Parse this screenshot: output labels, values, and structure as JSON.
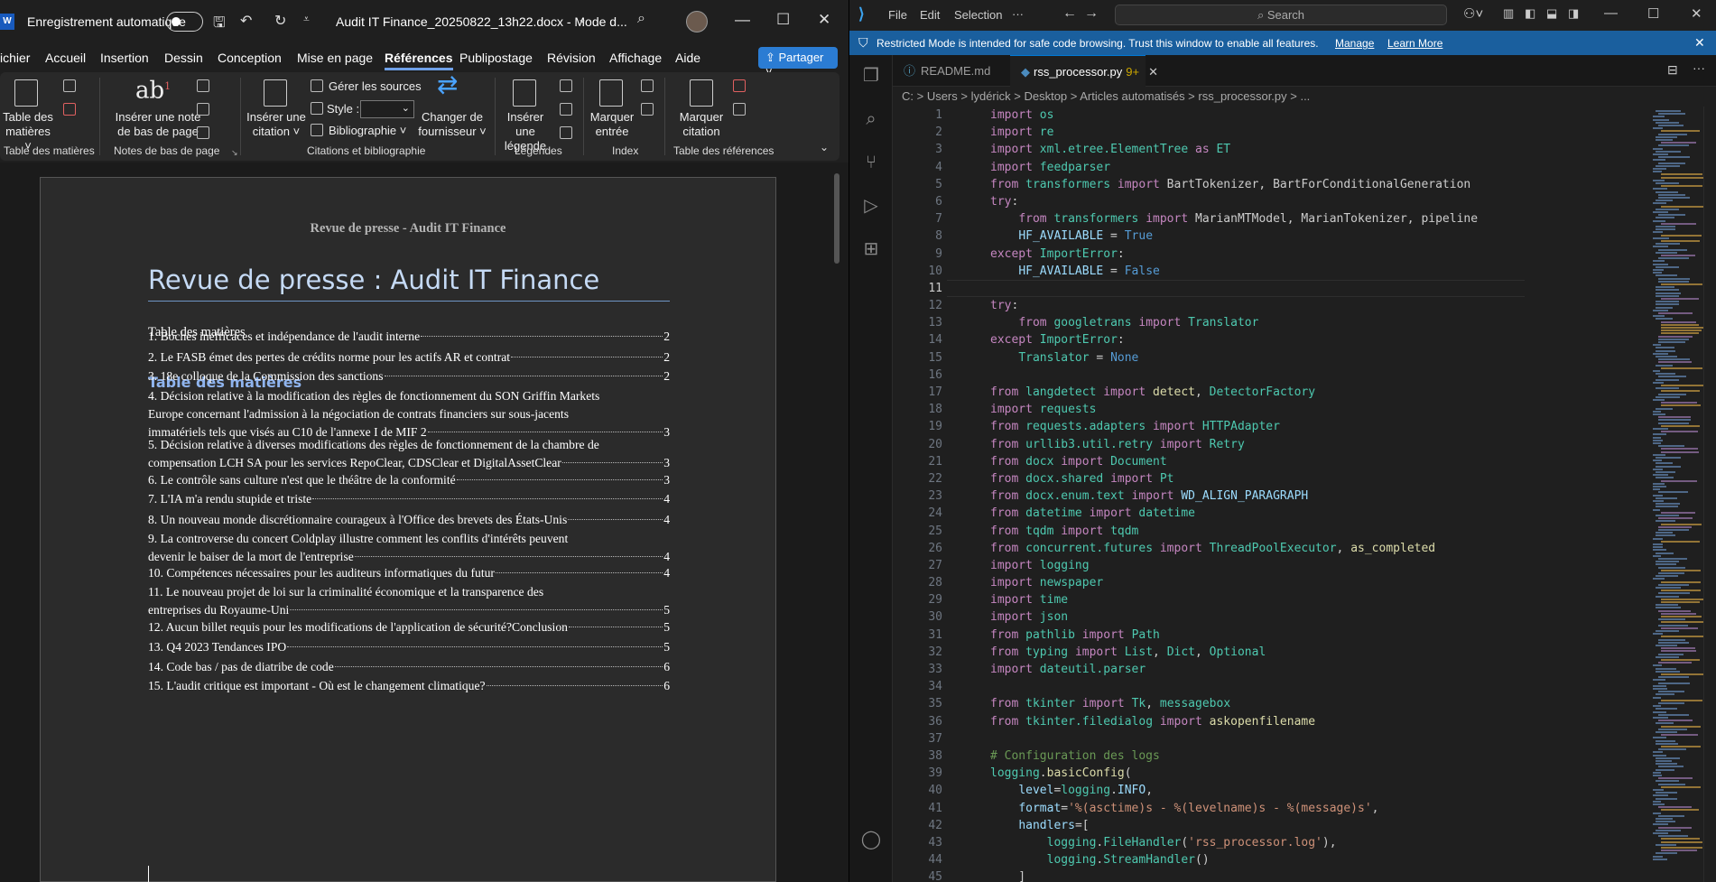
{
  "word": {
    "logo": "W",
    "autosave": "Enregistrement automatique",
    "doc_title": "Audit IT Finance_20250822_13h22.docx  -  Mode d...",
    "menu": [
      "ichier",
      "Accueil",
      "Insertion",
      "Dessin",
      "Conception",
      "Mise en page",
      "Références",
      "Publipostage",
      "Révision",
      "Affichage",
      "Aide"
    ],
    "share": "Partager",
    "ribbon": {
      "toc_btn": [
        "Table des",
        "matières ˅"
      ],
      "insert_note": [
        "Insérer une note",
        "de bas de page"
      ],
      "insert_citation": [
        "Insérer une",
        "citation ˅"
      ],
      "manage_sources": "Gérer les sources",
      "style": "Style :",
      "bibliography": "Bibliographie ˅",
      "change_provider": [
        "Changer de",
        "fournisseur ˅"
      ],
      "insert_caption": [
        "Insérer une",
        "légende"
      ],
      "mark_entry": [
        "Marquer",
        "entrée"
      ],
      "mark_citation": [
        "Marquer",
        "citation"
      ],
      "groups": [
        "Table des matières",
        "Notes de bas de page",
        "Citations et bibliographie",
        "Légendes",
        "Index",
        "Table des références"
      ]
    },
    "page": {
      "header": "Revue de presse - Audit IT Finance",
      "title": "Revue de presse : Audit IT Finance",
      "toc_label": "Table des matières",
      "toc_heading": "Table des matières",
      "entries": [
        {
          "lines": [
            "1. Boches inefficaces et indépendance de l'audit interne"
          ],
          "page": "2"
        },
        {
          "lines": [
            "2. Le FASB émet des pertes de crédits norme pour les actifs AR et contrat"
          ],
          "page": "2"
        },
        {
          "lines": [
            "3. 18e colloque de la Commission des sanctions"
          ],
          "page": "2"
        },
        {
          "lines": [
            "4. Décision relative à la modification des règles de fonctionnement du SON Griffin Markets",
            "Europe concernant l'admission à la négociation de contrats financiers sur sous-jacents",
            "immatériels tels que visés au C10 de l'annexe I de MIF 2"
          ],
          "page": "3"
        },
        {
          "lines": [
            "5. Décision relative à diverses modifications des règles de fonctionnement de la chambre de",
            "compensation LCH SA pour les services RepoClear, CDSClear et DigitalAssetClear"
          ],
          "page": "3"
        },
        {
          "lines": [
            "6. Le contrôle sans culture n'est que le théâtre de la conformité"
          ],
          "page": "3"
        },
        {
          "lines": [
            "7. L'IA m'a rendu stupide et triste"
          ],
          "page": "4"
        },
        {
          "lines": [
            "8. Un nouveau monde discrétionnaire courageux à l'Office des brevets des États-Unis"
          ],
          "page": "4"
        },
        {
          "lines": [
            "9. La controverse du concert Coldplay illustre comment les conflits d'intérêts peuvent",
            "devenir le baiser de la mort de l'entreprise"
          ],
          "page": "4"
        },
        {
          "lines": [
            "10. Compétences nécessaires pour les auditeurs informatiques du futur"
          ],
          "page": "4"
        },
        {
          "lines": [
            "11. Le nouveau projet de loi sur la criminalité économique et la transparence des",
            "entreprises du Royaume-Uni"
          ],
          "page": "5"
        },
        {
          "lines": [
            "12. Aucun billet requis pour les modifications de l'application de sécurité?Conclusion"
          ],
          "page": "5"
        },
        {
          "lines": [
            "13. Q4 2023 Tendances IPO"
          ],
          "page": "5"
        },
        {
          "lines": [
            "14. Code bas / pas de diatribe de code"
          ],
          "page": "6"
        },
        {
          "lines": [
            "15. L'audit critique est important - Où est le changement climatique?"
          ],
          "page": "6"
        }
      ]
    }
  },
  "vscode": {
    "menu": [
      "File",
      "Edit",
      "Selection",
      "···"
    ],
    "search": "Search",
    "banner": {
      "text": "Restricted Mode is intended for safe code browsing. Trust this window to enable all features.",
      "manage": "Manage",
      "learn": "Learn More"
    },
    "tabs": [
      {
        "label": "README.md"
      },
      {
        "label": "rss_processor.py",
        "mod": "9+"
      }
    ],
    "breadcrumb": "C: > Users > lydérick > Desktop > Articles automatisés > rss_processor.py > ...",
    "current_line": 11,
    "colors": {
      "kw": "#c586c0",
      "mod": "#4ec9b0",
      "fn": "#dcdcaa",
      "str": "#ce9178",
      "var": "#9cdcfe",
      "const": "#569cd6",
      "cmt": "#6a9955",
      "plain": "#cccccc"
    },
    "lines": [
      [
        [
          "kw",
          "import"
        ],
        [
          "plain",
          " "
        ],
        [
          "mod",
          "os"
        ]
      ],
      [
        [
          "kw",
          "import"
        ],
        [
          "plain",
          " "
        ],
        [
          "mod",
          "re"
        ]
      ],
      [
        [
          "kw",
          "import"
        ],
        [
          "plain",
          " "
        ],
        [
          "mod",
          "xml.etree.ElementTree"
        ],
        [
          "plain",
          " "
        ],
        [
          "kw",
          "as"
        ],
        [
          "plain",
          " "
        ],
        [
          "mod",
          "ET"
        ]
      ],
      [
        [
          "kw",
          "import"
        ],
        [
          "plain",
          " "
        ],
        [
          "mod",
          "feedparser"
        ]
      ],
      [
        [
          "kw",
          "from"
        ],
        [
          "plain",
          " "
        ],
        [
          "mod",
          "transformers"
        ],
        [
          "plain",
          " "
        ],
        [
          "kw",
          "import"
        ],
        [
          "plain",
          " BartTokenizer, BartForConditionalGeneration"
        ]
      ],
      [
        [
          "kw",
          "try"
        ],
        [
          "plain",
          ":"
        ]
      ],
      [
        [
          "plain",
          "    "
        ],
        [
          "kw",
          "from"
        ],
        [
          "plain",
          " "
        ],
        [
          "mod",
          "transformers"
        ],
        [
          "plain",
          " "
        ],
        [
          "kw",
          "import"
        ],
        [
          "plain",
          " MarianMTModel, MarianTokenizer, pipeline"
        ]
      ],
      [
        [
          "plain",
          "    "
        ],
        [
          "var",
          "HF_AVAILABLE"
        ],
        [
          "plain",
          " = "
        ],
        [
          "const",
          "True"
        ]
      ],
      [
        [
          "kw",
          "except"
        ],
        [
          "plain",
          " "
        ],
        [
          "mod",
          "ImportError"
        ],
        [
          "plain",
          ":"
        ]
      ],
      [
        [
          "plain",
          "    "
        ],
        [
          "var",
          "HF_AVAILABLE"
        ],
        [
          "plain",
          " = "
        ],
        [
          "const",
          "False"
        ]
      ],
      [],
      [
        [
          "kw",
          "try"
        ],
        [
          "plain",
          ":"
        ]
      ],
      [
        [
          "plain",
          "    "
        ],
        [
          "kw",
          "from"
        ],
        [
          "plain",
          " "
        ],
        [
          "mod",
          "googletrans"
        ],
        [
          "plain",
          " "
        ],
        [
          "kw",
          "import"
        ],
        [
          "plain",
          " "
        ],
        [
          "mod",
          "Translator"
        ]
      ],
      [
        [
          "kw",
          "except"
        ],
        [
          "plain",
          " "
        ],
        [
          "mod",
          "ImportError"
        ],
        [
          "plain",
          ":"
        ]
      ],
      [
        [
          "plain",
          "    "
        ],
        [
          "mod",
          "Translator"
        ],
        [
          "plain",
          " = "
        ],
        [
          "const",
          "None"
        ]
      ],
      [],
      [
        [
          "kw",
          "from"
        ],
        [
          "plain",
          " "
        ],
        [
          "mod",
          "langdetect"
        ],
        [
          "plain",
          " "
        ],
        [
          "kw",
          "import"
        ],
        [
          "plain",
          " "
        ],
        [
          "fn",
          "detect"
        ],
        [
          "plain",
          ", "
        ],
        [
          "mod",
          "DetectorFactory"
        ]
      ],
      [
        [
          "kw",
          "import"
        ],
        [
          "plain",
          " "
        ],
        [
          "mod",
          "requests"
        ]
      ],
      [
        [
          "kw",
          "from"
        ],
        [
          "plain",
          " "
        ],
        [
          "mod",
          "requests.adapters"
        ],
        [
          "plain",
          " "
        ],
        [
          "kw",
          "import"
        ],
        [
          "plain",
          " "
        ],
        [
          "mod",
          "HTTPAdapter"
        ]
      ],
      [
        [
          "kw",
          "from"
        ],
        [
          "plain",
          " "
        ],
        [
          "mod",
          "urllib3.util.retry"
        ],
        [
          "plain",
          " "
        ],
        [
          "kw",
          "import"
        ],
        [
          "plain",
          " "
        ],
        [
          "mod",
          "Retry"
        ]
      ],
      [
        [
          "kw",
          "from"
        ],
        [
          "plain",
          " "
        ],
        [
          "mod",
          "docx"
        ],
        [
          "plain",
          " "
        ],
        [
          "kw",
          "import"
        ],
        [
          "plain",
          " "
        ],
        [
          "mod",
          "Document"
        ]
      ],
      [
        [
          "kw",
          "from"
        ],
        [
          "plain",
          " "
        ],
        [
          "mod",
          "docx.shared"
        ],
        [
          "plain",
          " "
        ],
        [
          "kw",
          "import"
        ],
        [
          "plain",
          " "
        ],
        [
          "mod",
          "Pt"
        ]
      ],
      [
        [
          "kw",
          "from"
        ],
        [
          "plain",
          " "
        ],
        [
          "mod",
          "docx.enum.text"
        ],
        [
          "plain",
          " "
        ],
        [
          "kw",
          "import"
        ],
        [
          "plain",
          " "
        ],
        [
          "var",
          "WD_ALIGN_PARAGRAPH"
        ]
      ],
      [
        [
          "kw",
          "from"
        ],
        [
          "plain",
          " "
        ],
        [
          "mod",
          "datetime"
        ],
        [
          "plain",
          " "
        ],
        [
          "kw",
          "import"
        ],
        [
          "plain",
          " "
        ],
        [
          "mod",
          "datetime"
        ]
      ],
      [
        [
          "kw",
          "from"
        ],
        [
          "plain",
          " "
        ],
        [
          "mod",
          "tqdm"
        ],
        [
          "plain",
          " "
        ],
        [
          "kw",
          "import"
        ],
        [
          "plain",
          " "
        ],
        [
          "mod",
          "tqdm"
        ]
      ],
      [
        [
          "kw",
          "from"
        ],
        [
          "plain",
          " "
        ],
        [
          "mod",
          "concurrent.futures"
        ],
        [
          "plain",
          " "
        ],
        [
          "kw",
          "import"
        ],
        [
          "plain",
          " "
        ],
        [
          "mod",
          "ThreadPoolExecutor"
        ],
        [
          "plain",
          ", "
        ],
        [
          "fn",
          "as_completed"
        ]
      ],
      [
        [
          "kw",
          "import"
        ],
        [
          "plain",
          " "
        ],
        [
          "mod",
          "logging"
        ]
      ],
      [
        [
          "kw",
          "import"
        ],
        [
          "plain",
          " "
        ],
        [
          "mod",
          "newspaper"
        ]
      ],
      [
        [
          "kw",
          "import"
        ],
        [
          "plain",
          " "
        ],
        [
          "mod",
          "time"
        ]
      ],
      [
        [
          "kw",
          "import"
        ],
        [
          "plain",
          " "
        ],
        [
          "mod",
          "json"
        ]
      ],
      [
        [
          "kw",
          "from"
        ],
        [
          "plain",
          " "
        ],
        [
          "mod",
          "pathlib"
        ],
        [
          "plain",
          " "
        ],
        [
          "kw",
          "import"
        ],
        [
          "plain",
          " "
        ],
        [
          "mod",
          "Path"
        ]
      ],
      [
        [
          "kw",
          "from"
        ],
        [
          "plain",
          " "
        ],
        [
          "mod",
          "typing"
        ],
        [
          "plain",
          " "
        ],
        [
          "kw",
          "import"
        ],
        [
          "plain",
          " "
        ],
        [
          "mod",
          "List"
        ],
        [
          "plain",
          ", "
        ],
        [
          "mod",
          "Dict"
        ],
        [
          "plain",
          ", "
        ],
        [
          "mod",
          "Optional"
        ]
      ],
      [
        [
          "kw",
          "import"
        ],
        [
          "plain",
          " "
        ],
        [
          "mod",
          "dateutil.parser"
        ]
      ],
      [],
      [
        [
          "kw",
          "from"
        ],
        [
          "plain",
          " "
        ],
        [
          "mod",
          "tkinter"
        ],
        [
          "plain",
          " "
        ],
        [
          "kw",
          "import"
        ],
        [
          "plain",
          " "
        ],
        [
          "mod",
          "Tk"
        ],
        [
          "plain",
          ", "
        ],
        [
          "mod",
          "messagebox"
        ]
      ],
      [
        [
          "kw",
          "from"
        ],
        [
          "plain",
          " "
        ],
        [
          "mod",
          "tkinter.filedialog"
        ],
        [
          "plain",
          " "
        ],
        [
          "kw",
          "import"
        ],
        [
          "plain",
          " "
        ],
        [
          "fn",
          "askopenfilename"
        ]
      ],
      [],
      [
        [
          "cmt",
          "# Configuration des logs"
        ]
      ],
      [
        [
          "mod",
          "logging"
        ],
        [
          "plain",
          "."
        ],
        [
          "fn",
          "basicConfig"
        ],
        [
          "plain",
          "("
        ]
      ],
      [
        [
          "plain",
          "    "
        ],
        [
          "var",
          "level"
        ],
        [
          "plain",
          "="
        ],
        [
          "mod",
          "logging"
        ],
        [
          "plain",
          "."
        ],
        [
          "var",
          "INFO"
        ],
        [
          "plain",
          ","
        ]
      ],
      [
        [
          "plain",
          "    "
        ],
        [
          "var",
          "format"
        ],
        [
          "plain",
          "="
        ],
        [
          "str",
          "'%(asctime)s - %(levelname)s - %(message)s'"
        ],
        [
          "plain",
          ","
        ]
      ],
      [
        [
          "plain",
          "    "
        ],
        [
          "var",
          "handlers"
        ],
        [
          "plain",
          "=["
        ]
      ],
      [
        [
          "plain",
          "        "
        ],
        [
          "mod",
          "logging"
        ],
        [
          "plain",
          "."
        ],
        [
          "mod",
          "FileHandler"
        ],
        [
          "plain",
          "("
        ],
        [
          "str",
          "'rss_processor.log'"
        ],
        [
          "plain",
          "),"
        ]
      ],
      [
        [
          "plain",
          "        "
        ],
        [
          "mod",
          "logging"
        ],
        [
          "plain",
          "."
        ],
        [
          "mod",
          "StreamHandler"
        ],
        [
          "plain",
          "()"
        ]
      ],
      [
        [
          "plain",
          "    ]"
        ]
      ]
    ]
  }
}
